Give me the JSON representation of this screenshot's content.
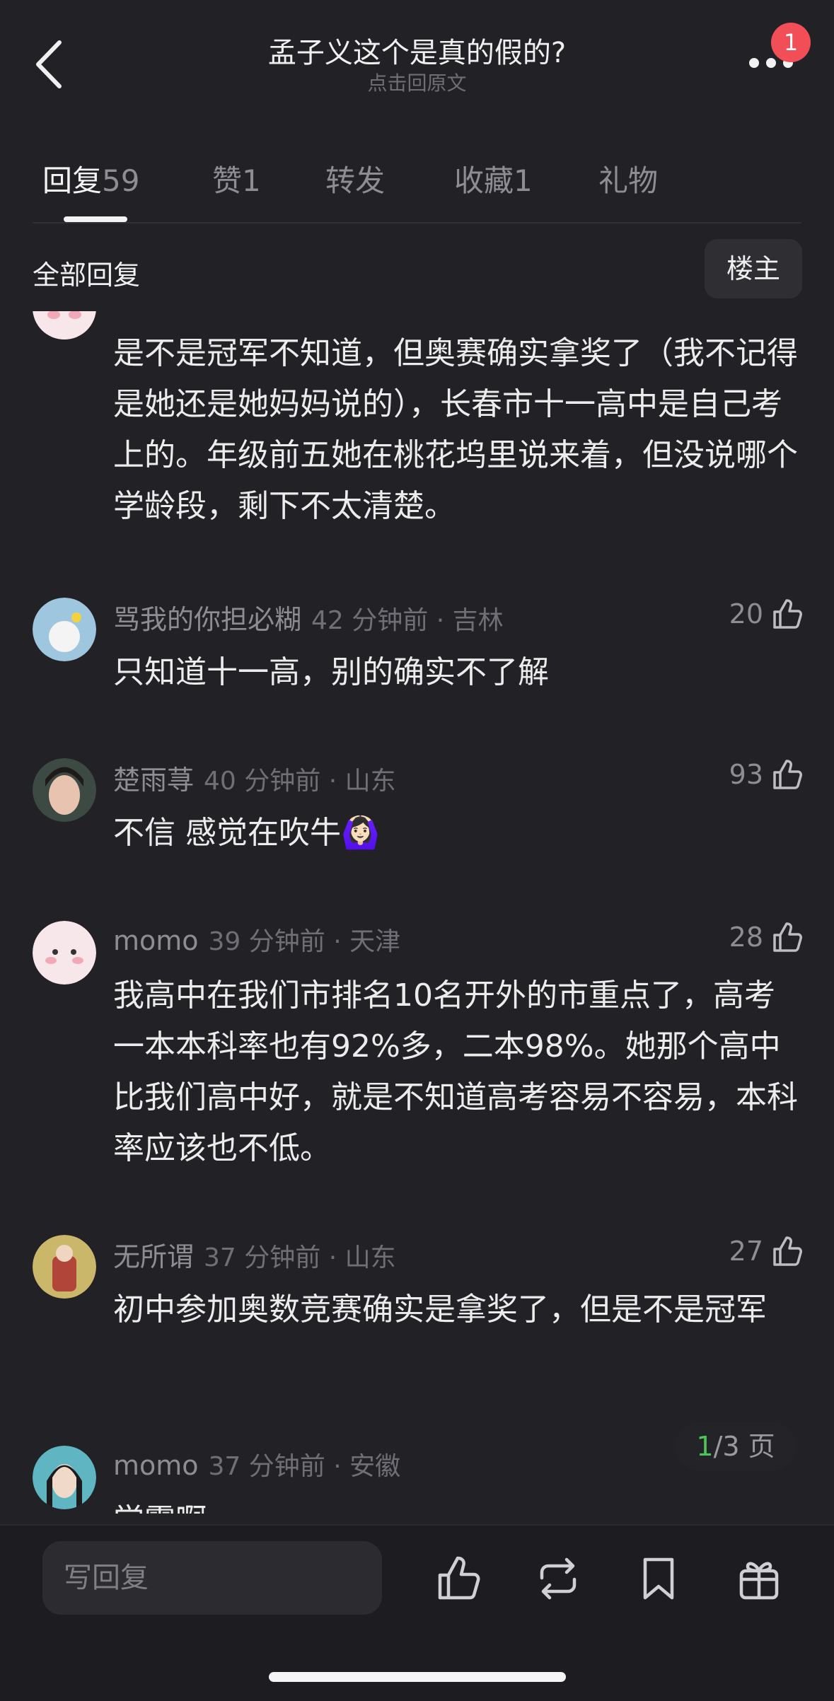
{
  "header": {
    "title": "孟子义这个是真的假的?",
    "subtitle": "点击回原文",
    "notification_count": "1"
  },
  "tabs": [
    {
      "label": "回复",
      "count": "59"
    },
    {
      "label": "赞",
      "count": "1"
    },
    {
      "label": "转发",
      "count": ""
    },
    {
      "label": "收藏",
      "count": "1"
    },
    {
      "label": "礼物",
      "count": ""
    }
  ],
  "filter": {
    "title": "全部回复",
    "owner_label": "楼主"
  },
  "comments": [
    {
      "user": "",
      "time": "",
      "likes": "",
      "text": "是不是冠军不知道，但奥赛确实拿奖了（我不记得是她还是她妈妈说的），长春市十一高中是自己考上的。年级前五她在桃花坞里说来着，但没说哪个学龄段，剩下不太清楚。"
    },
    {
      "user": "骂我的你担必糊",
      "time": "42 分钟前 · 吉林",
      "likes": "20",
      "text": "只知道十一高，别的确实不了解"
    },
    {
      "user": "楚雨荨",
      "time": "40 分钟前 · 山东",
      "likes": "93",
      "text": "不信 感觉在吹牛🙆🏻‍♀️"
    },
    {
      "user": "momo",
      "time": "39 分钟前 · 天津",
      "likes": "28",
      "text": "我高中在我们市排名10名开外的市重点了，高考一本本科率也有92%多，二本98%。她那个高中比我们高中好，就是不知道高考容易不容易，本科率应该也不低。"
    },
    {
      "user": "无所谓",
      "time": "37 分钟前 · 山东",
      "likes": "27",
      "text": "初中参加奥数竞赛确实是拿奖了，但是不是冠军"
    },
    {
      "user": "momo",
      "time": "37 分钟前 · 安徽",
      "likes": "",
      "text": "学霸啊"
    }
  ],
  "pager": {
    "current": "1",
    "total": "/3 页"
  },
  "bottom_bar": {
    "reply_placeholder": "写回复",
    "icons": [
      "like-icon",
      "repost-icon",
      "bookmark-icon",
      "gift-icon"
    ]
  },
  "colors": {
    "background": "#212126",
    "accent_green": "#4cc45b",
    "badge_red": "#f24e57"
  }
}
